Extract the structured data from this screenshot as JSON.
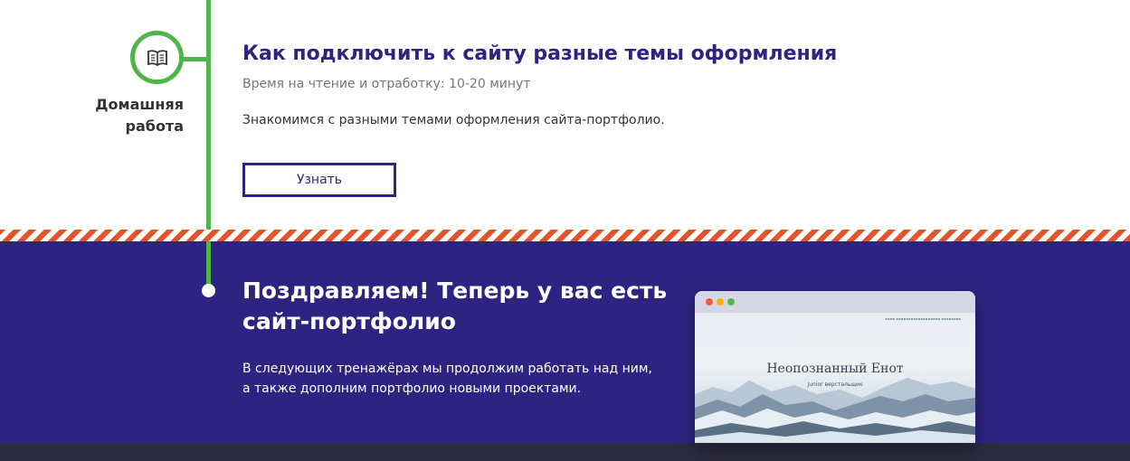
{
  "lesson": {
    "title": "Как подключить к сайту разные темы оформления",
    "time": "Время на чтение и отработку: 10-20 минут",
    "description": "Знакомимся с разными темами оформления сайта-портфолио.",
    "button_label": "Узнать"
  },
  "step": {
    "label_line1": "Домашняя",
    "label_line2": "работа",
    "icon": "open-book-icon"
  },
  "congrats": {
    "title": "Поздравляем! Теперь у вас есть сайт-портфолио",
    "text_line1": "В следующих тренажёрах мы продолжим работать над ним,",
    "text_line2": "а также дополним портфолио новыми проектами."
  },
  "preview": {
    "site_name": "Неопознанный Енот",
    "site_subtitle": "Junior верстальщик"
  },
  "colors": {
    "accent": "#2f2382",
    "timeline": "#4fb54a",
    "stripe": "#e0552a",
    "footer": "#2c2b40"
  }
}
